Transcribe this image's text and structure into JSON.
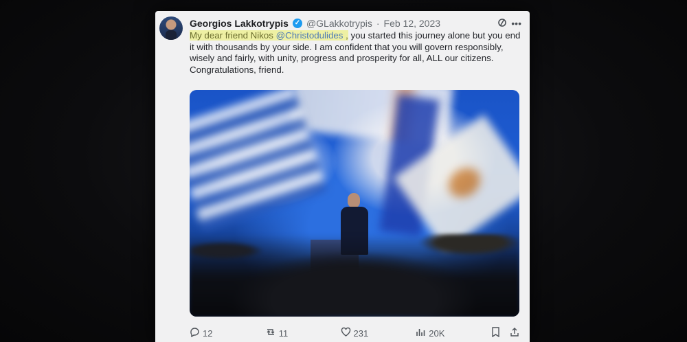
{
  "tweet": {
    "author_name": "Georgios Lakkotrypis",
    "handle": "@GLakkotrypis",
    "separator": "·",
    "date": "Feb 12, 2023",
    "text": {
      "highlight_prefix": "My dear friend Nikos ",
      "mention": "@Christodulides",
      "highlight_suffix": " ,",
      "body": " you started this journey alone but you end it with thousands by your side. I am confident that you will govern responsibly, wisely and fairly, with unity, progress and prosperity for all, ALL our citizens. Congratulations, friend."
    },
    "stats": {
      "replies": "12",
      "reposts": "11",
      "likes": "231",
      "views": "20K"
    }
  },
  "icons": {
    "verified": "verified-badge-icon",
    "grok": "grok-icon",
    "more": "more-icon",
    "reply": "reply-icon",
    "repost": "repost-icon",
    "like": "like-icon",
    "views": "views-icon",
    "bookmark": "bookmark-icon",
    "share": "share-icon"
  },
  "colors": {
    "verified": "#1d9bf0",
    "highlight": "#ecf078",
    "mention": "#4d7ab5"
  }
}
